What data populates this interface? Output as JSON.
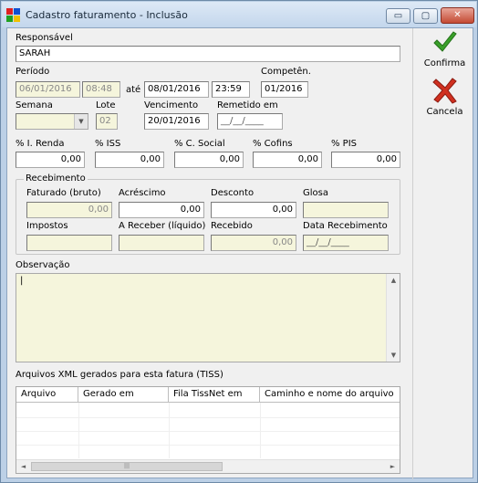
{
  "window": {
    "title": "Cadastro faturamento - Inclusão",
    "minimize_glyph": "▭",
    "maximize_glyph": "▢",
    "close_glyph": "✕"
  },
  "responsavel": {
    "label": "Responsável",
    "value": "SARAH"
  },
  "periodo": {
    "label": "Período",
    "start_date": "06/01/2016",
    "start_time": "08:48",
    "ate": "até",
    "end_date": "08/01/2016",
    "end_time": "23:59"
  },
  "competencia": {
    "label": "Competên.",
    "value": "01/2016"
  },
  "semana": {
    "label": "Semana",
    "value": ""
  },
  "lote": {
    "label": "Lote",
    "value": "02"
  },
  "vencimento": {
    "label": "Vencimento",
    "value": "20/01/2016"
  },
  "remetido": {
    "label": "Remetido em",
    "value": "__/__/____"
  },
  "taxes": [
    {
      "label": "% I. Renda",
      "value": "0,00"
    },
    {
      "label": "% ISS",
      "value": "0,00"
    },
    {
      "label": "% C. Social",
      "value": "0,00"
    },
    {
      "label": "% Cofins",
      "value": "0,00"
    },
    {
      "label": "% PIS",
      "value": "0,00"
    }
  ],
  "recebimento": {
    "title": "Recebimento",
    "faturado": {
      "label": "Faturado (bruto)",
      "value": "0,00"
    },
    "acrescimo": {
      "label": "Acréscimo",
      "value": "0,00"
    },
    "desconto": {
      "label": "Desconto",
      "value": "0,00"
    },
    "glosa": {
      "label": "Glosa",
      "value": ""
    },
    "impostos": {
      "label": "Impostos",
      "value": ""
    },
    "a_receber": {
      "label": "A Receber (líquido)",
      "value": ""
    },
    "recebido": {
      "label": "Recebido",
      "value": "0,00"
    },
    "data_recebimento": {
      "label": "Data Recebimento",
      "value": "__/__/____"
    }
  },
  "observacao": {
    "label": "Observação",
    "value": "|"
  },
  "arquivos": {
    "label": "Arquivos XML gerados para esta fatura (TISS)",
    "columns": [
      "Arquivo",
      "Gerado em",
      "Fila TissNet em",
      "Caminho e nome do arquivo"
    ],
    "rows": []
  },
  "actions": {
    "confirma": "Confirma",
    "cancela": "Cancela"
  },
  "scroll": {
    "up": "▲",
    "down": "▼",
    "left": "◄",
    "right": "►",
    "grip": "|||"
  },
  "colors": {
    "confirm_icon": "#3aa02a",
    "cancel_icon": "#d03020",
    "readonly_field": "#f5f5dc"
  }
}
